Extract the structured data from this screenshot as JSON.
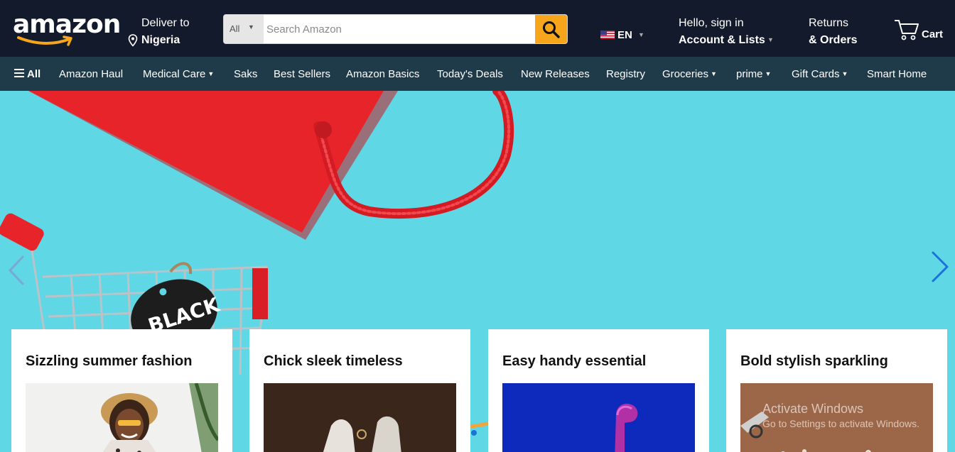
{
  "header": {
    "logo_text": "amazon",
    "deliver": {
      "line1": "Deliver to",
      "line2": "Nigeria"
    },
    "search": {
      "category": "All",
      "placeholder": "Search Amazon"
    },
    "language": {
      "code": "EN"
    },
    "account": {
      "line1": "Hello, sign in",
      "line2": "Account & Lists"
    },
    "returns": {
      "line1": "Returns",
      "line2": "& Orders"
    },
    "cart": {
      "label": "Cart"
    }
  },
  "nav": {
    "all_label": "All",
    "items": [
      {
        "label": "Amazon Haul",
        "dropdown": false
      },
      {
        "label": "Medical Care",
        "dropdown": true
      },
      {
        "label": "Saks",
        "dropdown": false
      },
      {
        "label": "Best Sellers",
        "dropdown": false
      },
      {
        "label": "Amazon Basics",
        "dropdown": false
      },
      {
        "label": "Today's Deals",
        "dropdown": false
      },
      {
        "label": "New Releases",
        "dropdown": false
      },
      {
        "label": "Registry",
        "dropdown": false
      },
      {
        "label": "Groceries",
        "dropdown": true
      },
      {
        "label": "prime",
        "dropdown": true
      },
      {
        "label": "Gift Cards",
        "dropdown": true
      },
      {
        "label": "Smart Home",
        "dropdown": false
      }
    ]
  },
  "hero": {
    "tag_text": "BLACK"
  },
  "cards": [
    {
      "title": "Sizzling summer fashion"
    },
    {
      "title": "Chick sleek timeless"
    },
    {
      "title": "Easy handy essential"
    },
    {
      "title": "Bold stylish sparkling"
    }
  ],
  "watermark": {
    "line1": "Activate Windows",
    "line2": "Go to Settings to activate Windows."
  },
  "colors": {
    "header_bg": "#131a2c",
    "nav_bg": "#1f3a48",
    "search_button": "#f7a51b",
    "hero_bg": "#5fd7e4",
    "bag_red": "#e8242b",
    "carousel_arrow": "#1a73d9"
  }
}
